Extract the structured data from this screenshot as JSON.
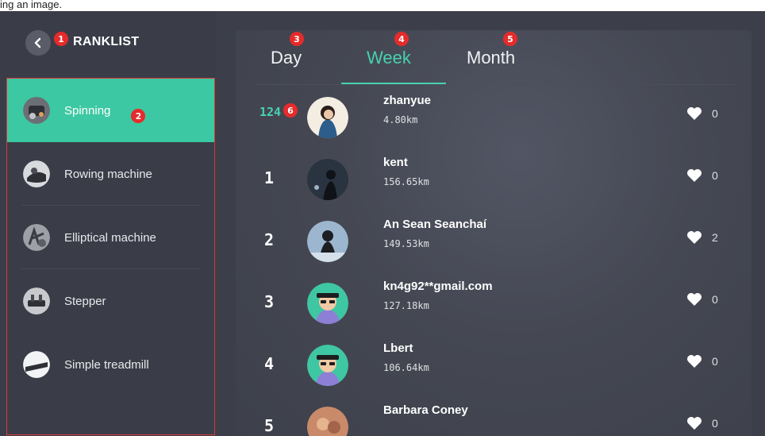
{
  "caption": "ing an image.",
  "header": {
    "title": "RANKLIST",
    "back_icon": "chevron-left-icon"
  },
  "colors": {
    "accent": "#46d1b0",
    "active_item_bg": "#3cc8a2",
    "marker": "#e52b2b",
    "panel_bg": "#3a3d48"
  },
  "markers": [
    "1",
    "2",
    "3",
    "4",
    "5",
    "6"
  ],
  "sidebar": {
    "items": [
      {
        "label": "Spinning",
        "active": true
      },
      {
        "label": "Rowing machine",
        "active": false
      },
      {
        "label": "Elliptical machine",
        "active": false
      },
      {
        "label": "Stepper",
        "active": false
      },
      {
        "label": "Simple treadmill",
        "active": false
      }
    ]
  },
  "tabs": [
    {
      "label": "Day",
      "active": false
    },
    {
      "label": "Week",
      "active": true
    },
    {
      "label": "Month",
      "active": false
    }
  ],
  "ranking": {
    "me": {
      "rank": "124",
      "name": "zhanyue",
      "distance": "4.80km",
      "likes": "0"
    },
    "rows": [
      {
        "rank": "1",
        "name": "kent",
        "distance": "156.65km",
        "likes": "0"
      },
      {
        "rank": "2",
        "name": "An Sean Seanchaí",
        "distance": "149.53km",
        "likes": "2"
      },
      {
        "rank": "3",
        "name": "kn4g92**gmail.com",
        "distance": "127.18km",
        "likes": "0"
      },
      {
        "rank": "4",
        "name": "Lbert",
        "distance": "106.64km",
        "likes": "0"
      },
      {
        "rank": "5",
        "name": "Barbara Coney",
        "distance": "",
        "likes": "0"
      }
    ]
  }
}
